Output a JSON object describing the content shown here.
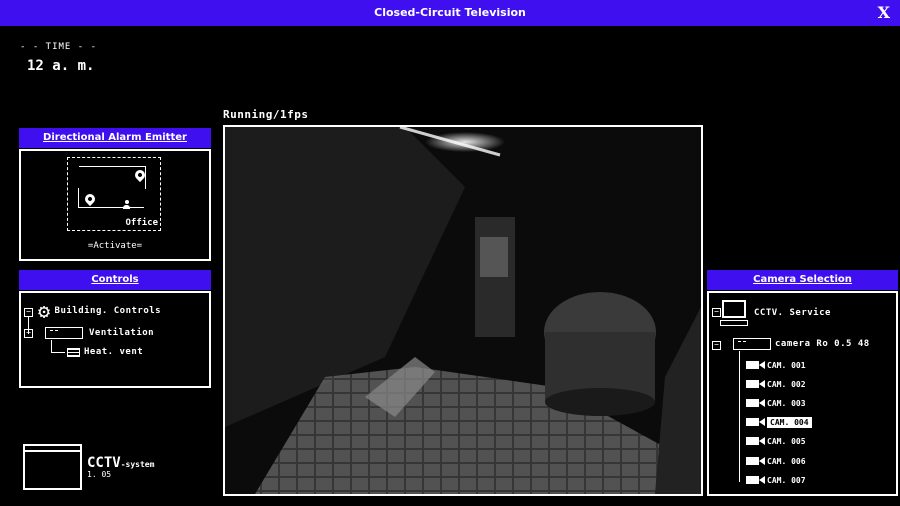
{
  "window": {
    "title": "Closed-Circuit Television",
    "close_label": "X"
  },
  "time": {
    "label": "- - TIME - -",
    "value": "12 a. m."
  },
  "alarm_panel": {
    "title": "Directional Alarm Emitter",
    "map_label": "Office",
    "activate_label": "=Activate="
  },
  "controls_panel": {
    "title": "Controls",
    "items": [
      {
        "label": "Building. Controls",
        "icon": "gear-icon"
      },
      {
        "label": "Ventilation",
        "icon": "device-icon"
      },
      {
        "label": "Heat. vent",
        "icon": "vent-icon"
      }
    ]
  },
  "viewer": {
    "status": "Running/1fps"
  },
  "camera_panel": {
    "title": "Camera Selection",
    "service_label": "CCTV. Service",
    "group_label": "camera Ro 0.5 48",
    "cameras": [
      "CAM. 001",
      "CAM. 002",
      "CAM. 003",
      "CAM. 004",
      "CAM. 005",
      "CAM. 006",
      "CAM. 007"
    ],
    "selected": "CAM. 004"
  },
  "system": {
    "name": "CCTV",
    "suffix": "-system",
    "version": "1. 05"
  },
  "colors": {
    "accent": "#3f0ff0",
    "background": "#000000",
    "foreground": "#ffffff"
  }
}
